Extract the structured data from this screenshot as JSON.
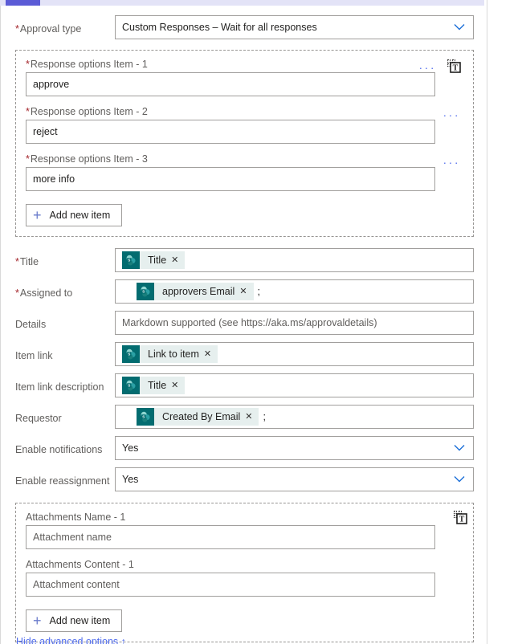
{
  "accent": {
    "progress_track": "#e3e3f7",
    "progress_fill": "#5b5bd6",
    "link_blue": "#4f6bed",
    "required_red": "#a4262c",
    "sharepoint_teal": "#036c70",
    "chip_bg": "#e6efee"
  },
  "approval_type": {
    "label": "Approval type",
    "required": true,
    "value": "Custom Responses – Wait for all responses",
    "chevron_icon": "chevron-down-icon"
  },
  "response_options": {
    "items": [
      {
        "label": "Response options Item - 1",
        "label_main": "Response options Item -",
        "label_index": "1",
        "required": true,
        "value": "approve",
        "ellipsis": "···",
        "has_text_toggle": true,
        "text_toggle_icon": "switch-to-text-mode-icon"
      },
      {
        "label": "Response options Item - 2",
        "label_main": "Response options Item -",
        "label_index": "2",
        "required": true,
        "value": "reject",
        "ellipsis": "···",
        "has_text_toggle": false
      },
      {
        "label": "Response options Item - 3",
        "label_main": "Response options Item -",
        "label_index": "3",
        "required": true,
        "value": "more info",
        "ellipsis": "···",
        "has_text_toggle": false
      }
    ],
    "add_button_label": "Add new item",
    "add_button_icon": "plus-icon"
  },
  "fields": [
    {
      "name": "title",
      "label": "Title",
      "required": true,
      "type": "tokens",
      "indent": 0,
      "tokens": [
        {
          "icon": "sharepoint-icon",
          "label": "Title",
          "remove": "✕"
        }
      ],
      "suffix": ""
    },
    {
      "name": "assigned-to",
      "label": "Assigned to",
      "required": true,
      "type": "tokens",
      "indent": 18,
      "tokens": [
        {
          "icon": "sharepoint-icon",
          "label": "approvers Email",
          "remove": "✕"
        }
      ],
      "suffix": ";"
    },
    {
      "name": "details",
      "label": "Details",
      "required": false,
      "type": "placeholder",
      "placeholder": "Markdown supported (see https://aka.ms/approvaldetails)"
    },
    {
      "name": "item-link",
      "label": "Item link",
      "required": false,
      "type": "tokens",
      "indent": 0,
      "tokens": [
        {
          "icon": "sharepoint-icon",
          "label": "Link to item",
          "remove": "✕"
        }
      ],
      "suffix": ""
    },
    {
      "name": "item-link-description",
      "label": "Item link description",
      "required": false,
      "type": "tokens",
      "indent": 0,
      "tokens": [
        {
          "icon": "sharepoint-icon",
          "label": "Title",
          "remove": "✕"
        }
      ],
      "suffix": ""
    },
    {
      "name": "requestor",
      "label": "Requestor",
      "required": false,
      "type": "tokens",
      "indent": 18,
      "tokens": [
        {
          "icon": "sharepoint-icon",
          "label": "Created By Email",
          "remove": "✕"
        }
      ],
      "suffix": ";"
    },
    {
      "name": "enable-notifications",
      "label": "Enable notifications",
      "required": false,
      "type": "dropdown",
      "value": "Yes",
      "chevron_icon": "chevron-down-icon"
    },
    {
      "name": "enable-reassignment",
      "label": "Enable reassignment",
      "required": false,
      "type": "dropdown",
      "value": "Yes",
      "chevron_icon": "chevron-down-icon"
    }
  ],
  "attachments": {
    "text_toggle_icon": "switch-to-text-mode-icon",
    "items": [
      {
        "label": "Attachments Name - 1",
        "label_main": "Attachments Name - 1",
        "label_index": "",
        "placeholder": "Attachment name",
        "wrapped": false
      },
      {
        "label": "Attachments Content - 1",
        "label_main": "Attachments Content -",
        "label_index": "1",
        "placeholder": "Attachment content",
        "wrapped": true
      }
    ],
    "add_button_label": "Add new item",
    "add_button_icon": "plus-icon"
  },
  "footer": {
    "hide_advanced_label": "Hide advanced options  ↑"
  }
}
